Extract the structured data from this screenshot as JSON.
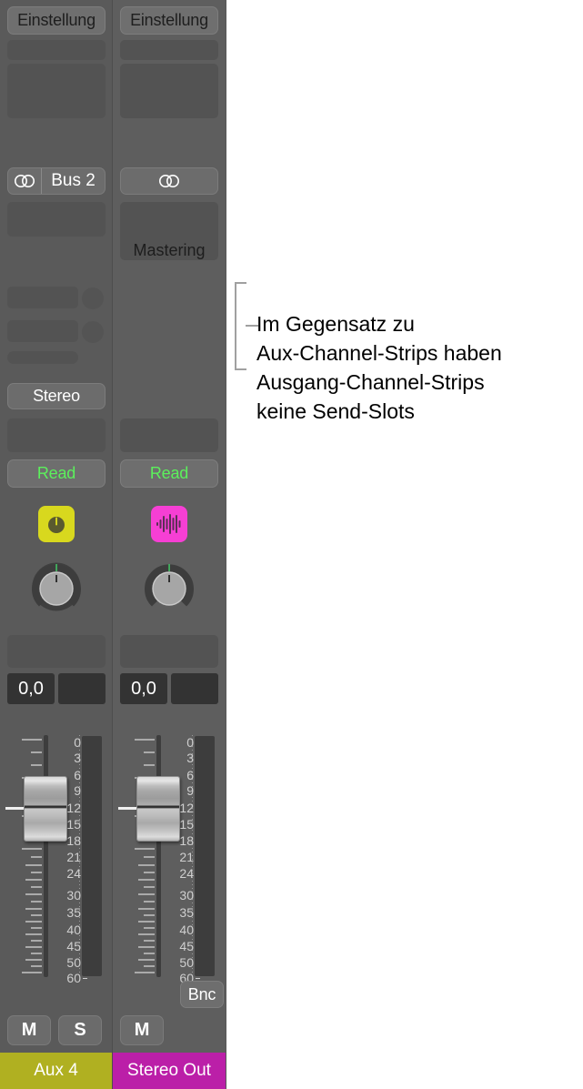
{
  "app": {
    "region": "logic-pro-mixer-channel-strips"
  },
  "annotation": {
    "lines": [
      "Im Gegensatz zu",
      "Aux-Channel-Strips haben",
      "Ausgang-Channel-Strips",
      "keine Send-Slots"
    ],
    "text_color": "#000000",
    "bracket_color": "#a0a0a0"
  },
  "db_scale": {
    "labels": [
      "0",
      "3",
      "6",
      "9",
      "12",
      "15",
      "18",
      "21",
      "24",
      "30",
      "35",
      "40",
      "45",
      "50",
      "60"
    ]
  },
  "strips": [
    {
      "id": "aux-4",
      "settings_label": "Einstellung",
      "io_icon": "stereo-circles-icon",
      "io_label": "Bus 2",
      "has_io_label": true,
      "output_text": "",
      "has_sends": true,
      "format_label": "Stereo",
      "automation_label": "Read",
      "automation_color": "#5cf05c",
      "plugin_icon": "knob-plugin-icon",
      "plugin_icon_color": "#d8d81e",
      "pan_value": "0,0",
      "level_value": "",
      "bounce_label": "",
      "has_bounce": false,
      "mute_label": "M",
      "solo_label": "S",
      "has_solo": true,
      "name": "Aux 4",
      "name_color": "#b0b021"
    },
    {
      "id": "stereo-out",
      "settings_label": "Einstellung",
      "io_icon": "stereo-circles-icon",
      "io_label": "",
      "has_io_label": false,
      "output_text": "Mastering",
      "has_sends": false,
      "format_label": "",
      "automation_label": "Read",
      "automation_color": "#5cf05c",
      "plugin_icon": "waveform-plugin-icon",
      "plugin_icon_color": "#f63fd4",
      "pan_value": "0,0",
      "level_value": "",
      "bounce_label": "Bnc",
      "has_bounce": true,
      "mute_label": "M",
      "solo_label": "",
      "has_solo": false,
      "name": "Stereo Out",
      "name_color": "#bb1fa8"
    }
  ]
}
